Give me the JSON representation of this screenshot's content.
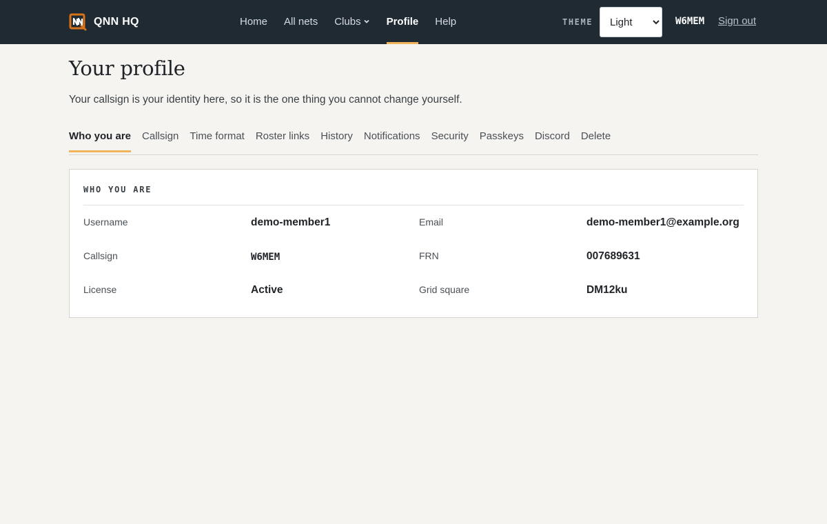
{
  "header": {
    "brand": "QNN HQ",
    "nav": [
      {
        "label": "Home"
      },
      {
        "label": "All nets"
      },
      {
        "label": "Clubs",
        "has_dropdown": true
      },
      {
        "label": "Profile",
        "active": true
      },
      {
        "label": "Help"
      }
    ],
    "theme_label": "THEME",
    "theme_selected": "Light",
    "theme_options": [
      "Light"
    ],
    "callsign": "W6MEM",
    "signout_label": "Sign out"
  },
  "page": {
    "title": "Your profile",
    "subtitle": "Your callsign is your identity here, so it is the one thing you cannot change yourself.",
    "tabs": [
      "Who you are",
      "Callsign",
      "Time format",
      "Roster links",
      "History",
      "Notifications",
      "Security",
      "Passkeys",
      "Discord",
      "Delete"
    ],
    "active_tab": "Who you are"
  },
  "panel": {
    "title": "WHO YOU ARE",
    "fields": {
      "username": {
        "label": "Username",
        "value": "demo-member1"
      },
      "email": {
        "label": "Email",
        "value": "demo-member1@example.org"
      },
      "callsign": {
        "label": "Callsign",
        "value": "W6MEM"
      },
      "frn": {
        "label": "FRN",
        "value": "007689631"
      },
      "license": {
        "label": "License",
        "value": "Active"
      },
      "grid": {
        "label": "Grid square",
        "value": "DM12ku"
      }
    }
  },
  "colors": {
    "topbar": "#1f2a33",
    "accent": "#f0b45a",
    "logo": "#d9731a",
    "background": "#f5f4f0"
  },
  "icons": {
    "logo": "qnn-logo-icon",
    "dropdown": "chevron-down-icon"
  }
}
